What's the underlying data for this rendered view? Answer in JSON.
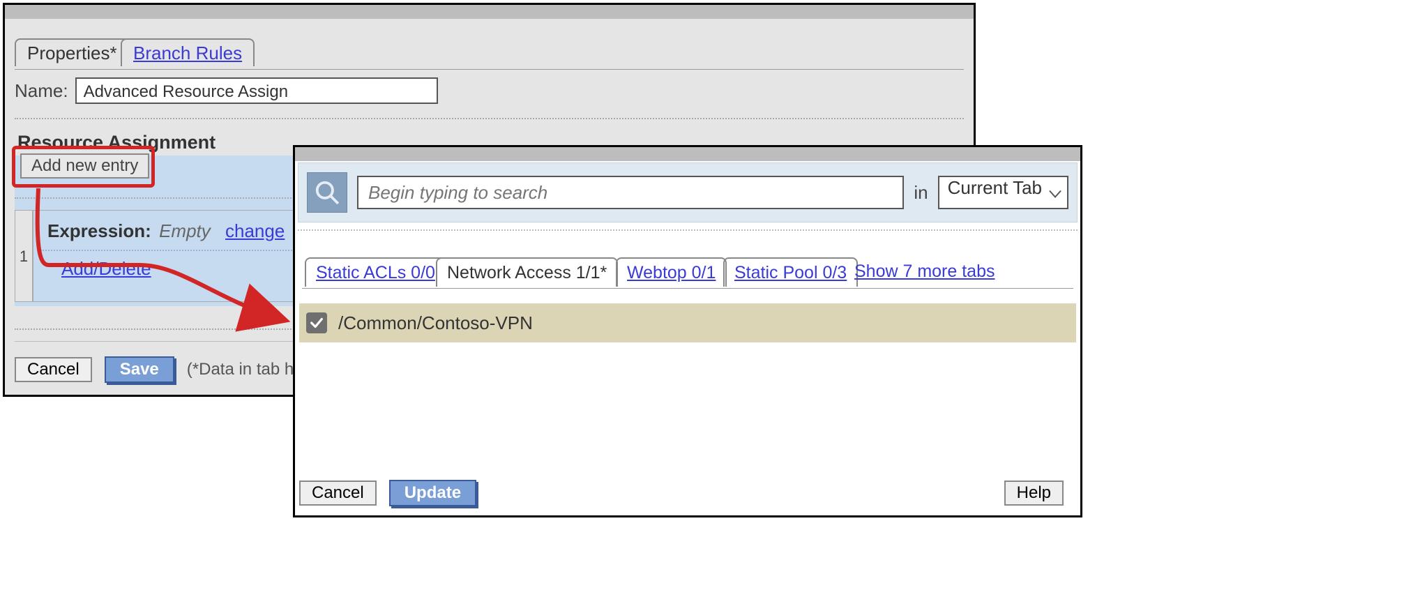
{
  "back": {
    "tabs": {
      "properties": "Properties*",
      "branch_rules": "Branch Rules"
    },
    "name_label": "Name:",
    "name_value": "Advanced Resource Assign",
    "section_heading": "Resource Assignment",
    "add_entry": "Add new entry",
    "row_index": "1",
    "expression_label": "Expression",
    "expression_value": "Empty",
    "change_link": "change",
    "add_delete": "Add/Delete",
    "cancel": "Cancel",
    "save": "Save",
    "data_hint": "(*Data in tab has"
  },
  "front": {
    "search_placeholder": "Begin typing to search",
    "in_label": "in",
    "scope_value": "Current Tab",
    "tabs": {
      "static_acls": "Static ACLs 0/0",
      "network_access": "Network Access 1/1*",
      "webtop": "Webtop 0/1",
      "static_pool": "Static Pool 0/3",
      "more": "Show 7 more tabs"
    },
    "resource": "/Common/Contoso-VPN",
    "resource_checked": true,
    "cancel": "Cancel",
    "update": "Update",
    "help": "Help"
  }
}
